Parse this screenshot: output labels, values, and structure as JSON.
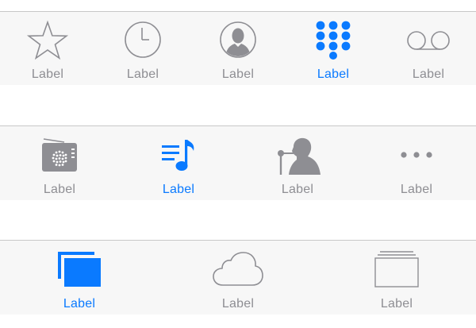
{
  "colors": {
    "active": "#0a7aff",
    "inactive": "#8e8e93",
    "bar_background": "#f7f7f7",
    "bar_border": "#c8c8c8"
  },
  "tabbar_1": {
    "tabs": [
      {
        "icon": "star-icon",
        "label": "Label",
        "active": false
      },
      {
        "icon": "clock-icon",
        "label": "Label",
        "active": false
      },
      {
        "icon": "contact-icon",
        "label": "Label",
        "active": false
      },
      {
        "icon": "keypad-icon",
        "label": "Label",
        "active": true
      },
      {
        "icon": "voicemail-icon",
        "label": "Label",
        "active": false
      }
    ]
  },
  "tabbar_2": {
    "tabs": [
      {
        "icon": "radio-icon",
        "label": "Label",
        "active": false
      },
      {
        "icon": "music-playlist-icon",
        "label": "Label",
        "active": true
      },
      {
        "icon": "artist-microphone-icon",
        "label": "Label",
        "active": false
      },
      {
        "icon": "more-icon",
        "label": "Label",
        "active": false
      }
    ]
  },
  "tabbar_3": {
    "tabs": [
      {
        "icon": "stacked-windows-icon",
        "label": "Label",
        "active": true
      },
      {
        "icon": "cloud-icon",
        "label": "Label",
        "active": false
      },
      {
        "icon": "stacked-folders-icon",
        "label": "Label",
        "active": false
      }
    ]
  }
}
